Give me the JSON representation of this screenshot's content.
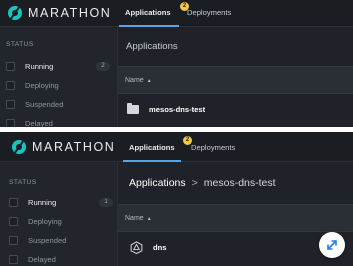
{
  "app": {
    "name": "MARATHON"
  },
  "nav": {
    "tabs": [
      {
        "label": "Applications",
        "active": true
      },
      {
        "label": "Deployments",
        "badge": "2"
      }
    ]
  },
  "sidebar": {
    "heading": "STATUS",
    "top_items": [
      {
        "label": "Running",
        "count": "2"
      },
      {
        "label": "Deploying"
      },
      {
        "label": "Suspended"
      },
      {
        "label": "Delayed"
      }
    ],
    "bottom_items": [
      {
        "label": "Running",
        "count": "1"
      },
      {
        "label": "Deploying"
      },
      {
        "label": "Suspended"
      },
      {
        "label": "Delayed"
      }
    ]
  },
  "top_view": {
    "title": "Applications",
    "column_header": "Name",
    "sort_indicator": "▲",
    "rows": [
      {
        "name": "mesos-dns-test",
        "icon": "folder-icon"
      }
    ]
  },
  "bottom_view": {
    "breadcrumb": {
      "root": "Applications",
      "separator": ">",
      "current": "mesos-dns-test"
    },
    "column_header": "Name",
    "sort_indicator": "▲",
    "rows": [
      {
        "name": "dns",
        "icon": "app-icon"
      }
    ],
    "fab_icon": "expand-icon"
  },
  "colors": {
    "accent": "#5aa3e4",
    "badge": "#f4c843",
    "logo": "#19c4c0",
    "fab_icon": "#2a7de1"
  }
}
